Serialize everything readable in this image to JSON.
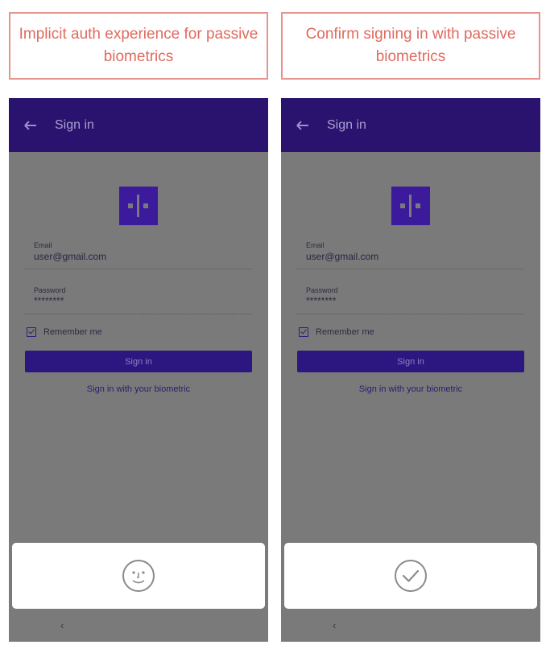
{
  "captions": {
    "left": "Implicit auth experience for passive biometrics",
    "right": "Confirm signing in with passive biometrics"
  },
  "screen": {
    "app_title": "Sign in",
    "email_label": "Email",
    "email_value": "user@gmail.com",
    "password_label": "Password",
    "password_value": "********",
    "remember_label": "Remember me",
    "remember_checked": true,
    "signin_button": "Sign in",
    "biometric_link": "Sign in with your biometric",
    "nav_back": "‹"
  },
  "left_sheet": {
    "icon": "face-icon"
  },
  "right_sheet": {
    "icon": "checkmark-circle-icon"
  },
  "colors": {
    "caption_border": "#e8948e",
    "caption_text": "#e06a5e",
    "app_bar": "#29136e",
    "primary": "#2c1680",
    "scrim": "#7a7a7a"
  }
}
